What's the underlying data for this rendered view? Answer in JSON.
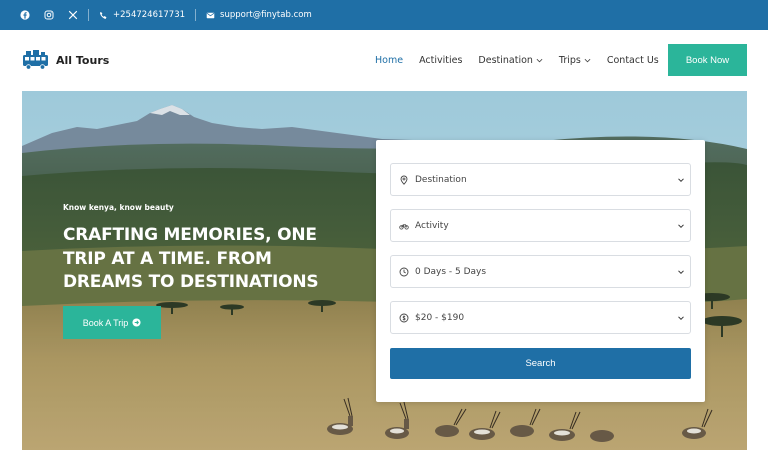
{
  "topbar": {
    "social_icons": [
      "facebook-icon",
      "instagram-icon",
      "x-icon"
    ],
    "phone": "+254724617731",
    "email": "support@finytab.com",
    "background": "#1f6fa6"
  },
  "nav": {
    "brand": "All Tours",
    "items": [
      {
        "label": "Home",
        "active": true,
        "dropdown": false
      },
      {
        "label": "Activities",
        "active": false,
        "dropdown": false
      },
      {
        "label": "Destination",
        "active": false,
        "dropdown": true
      },
      {
        "label": "Trips",
        "active": false,
        "dropdown": true
      },
      {
        "label": "Contact Us",
        "active": false,
        "dropdown": false
      }
    ],
    "cta_label": "Book Now",
    "accent": "#2bb59a"
  },
  "hero": {
    "tagline": "Know kenya, know beauty",
    "headline": "CRAFTING MEMORIES, ONE TRIP AT A TIME. FROM DREAMS TO DESTINATIONS",
    "cta_label": "Book A Trip"
  },
  "search": {
    "fields": [
      {
        "value": "Destination",
        "icon": "map-pin-icon"
      },
      {
        "value": "Activity",
        "icon": "bicycle-icon"
      },
      {
        "value": "0 Days - 5 Days",
        "icon": "clock-icon"
      },
      {
        "value": "$20 - $190",
        "icon": "dollar-icon"
      }
    ],
    "button_label": "Search",
    "button_color": "#1f6fa6"
  }
}
